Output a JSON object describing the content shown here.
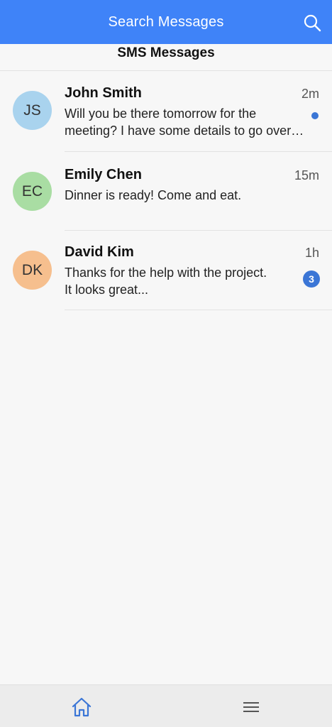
{
  "header": {
    "search_title": "Search Messages"
  },
  "section": {
    "title": "SMS Messages"
  },
  "conversations": [
    {
      "initials": "JS",
      "name": "John Smith",
      "time": "2m",
      "preview_line1": "Will you be there tomorrow for the",
      "preview_line2": "meeting? I have some details to go over…",
      "avatar_color": "#a9d3ee",
      "unread": "dot"
    },
    {
      "initials": "EC",
      "name": "Emily Chen",
      "time": "15m",
      "preview_line1": "Dinner is ready! Come and eat.",
      "preview_line2": "",
      "avatar_color": "#a9dda3",
      "unread": "none"
    },
    {
      "initials": "DK",
      "name": "David Kim",
      "time": "1h",
      "preview_line1": "Thanks for the help with the project.",
      "preview_line2": "It looks great...",
      "avatar_color": "#f6bf8e",
      "unread": "3"
    }
  ],
  "colors": {
    "accent": "#3f83f8",
    "badge": "#3b76d6"
  },
  "nav": {
    "home_icon": "home-icon",
    "menu_icon": "menu-icon"
  }
}
